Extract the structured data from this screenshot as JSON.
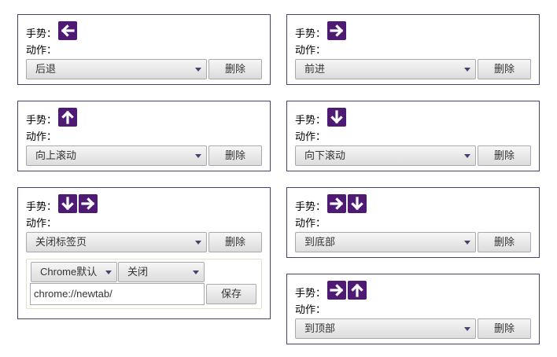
{
  "labels": {
    "gesture": "手势：",
    "action": "动作：",
    "delete": "删除",
    "save": "保存"
  },
  "cards": [
    {
      "gesture_icons": [
        "arrow-left-icon"
      ],
      "action": "后退"
    },
    {
      "gesture_icons": [
        "arrow-right-icon"
      ],
      "action": "前进"
    },
    {
      "gesture_icons": [
        "arrow-up-icon"
      ],
      "action": "向上滚动"
    },
    {
      "gesture_icons": [
        "arrow-down-icon"
      ],
      "action": "向下滚动"
    },
    {
      "gesture_icons": [
        "arrow-down-icon",
        "arrow-right-icon"
      ],
      "action": "关闭标签页",
      "options": {
        "browser_select": "Chrome默认",
        "mode_select": "关闭",
        "url_value": "chrome://newtab/"
      }
    },
    {
      "gesture_icons": [
        "arrow-right-icon",
        "arrow-down-icon"
      ],
      "action": "到底部"
    },
    {
      "gesture_icons": [
        "arrow-right-icon",
        "arrow-up-icon"
      ],
      "action": "到顶部"
    }
  ],
  "colors": {
    "icon_background": "#4e1a73",
    "card_border": "#4b3f6e"
  }
}
